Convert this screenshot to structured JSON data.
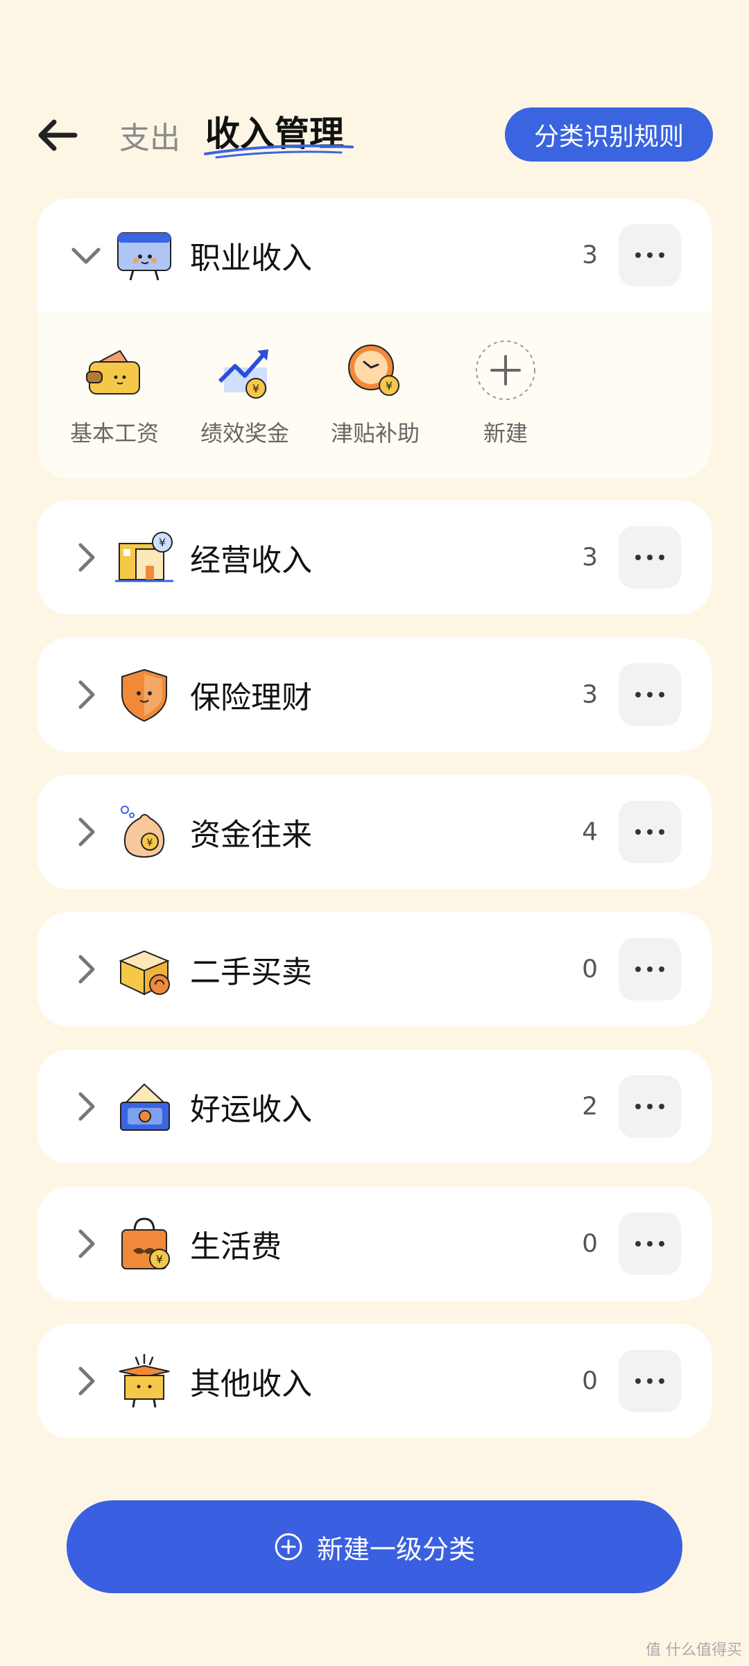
{
  "header": {
    "tab_expense": "支出",
    "tab_income": "收入管理",
    "rules_button": "分类识别规则",
    "accent_color": "#3a64e0"
  },
  "categories": [
    {
      "label": "职业收入",
      "count": "3",
      "icon": "wage-card-icon",
      "expanded": true,
      "subcategories": [
        {
          "label": "基本工资",
          "icon": "wallet-icon"
        },
        {
          "label": "绩效奖金",
          "icon": "growth-chart-icon"
        },
        {
          "label": "津贴补助",
          "icon": "clock-coin-icon"
        },
        {
          "label": "新建",
          "icon": "add-circle-icon"
        }
      ]
    },
    {
      "label": "经营收入",
      "count": "3",
      "icon": "shop-icon"
    },
    {
      "label": "保险理财",
      "count": "3",
      "icon": "shield-icon"
    },
    {
      "label": "资金往来",
      "count": "4",
      "icon": "money-bag-icon"
    },
    {
      "label": "二手买卖",
      "count": "0",
      "icon": "package-icon"
    },
    {
      "label": "好运收入",
      "count": "2",
      "icon": "lucky-envelope-icon"
    },
    {
      "label": "生活费",
      "count": "0",
      "icon": "shopping-bag-icon"
    },
    {
      "label": "其他收入",
      "count": "0",
      "icon": "open-box-icon"
    }
  ],
  "footer": {
    "new_category_button": "新建一级分类"
  },
  "watermark": "值 什么值得买"
}
